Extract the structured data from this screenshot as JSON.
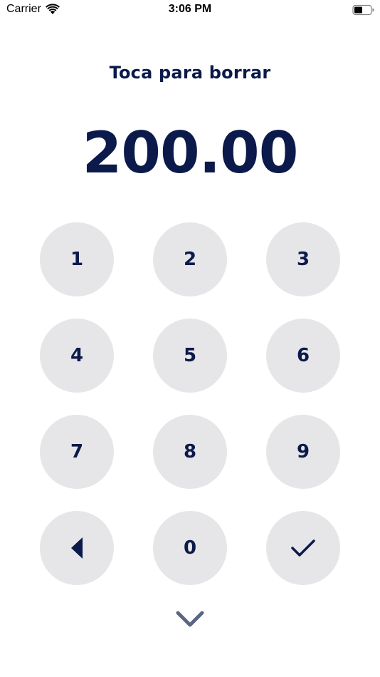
{
  "status_bar": {
    "carrier": "Carrier",
    "time": "3:06 PM"
  },
  "title": "Toca para borrar",
  "amount": "200.00",
  "keypad": {
    "keys": [
      "1",
      "2",
      "3",
      "4",
      "5",
      "6",
      "7",
      "8",
      "9",
      "0"
    ],
    "backspace_icon": "triangle-left-icon",
    "confirm_icon": "checkmark-icon"
  },
  "dismiss_icon": "chevron-down-icon",
  "colors": {
    "text": "#0b1a4a",
    "key_background": "#e6e6e8",
    "chevron": "#5b6685"
  }
}
